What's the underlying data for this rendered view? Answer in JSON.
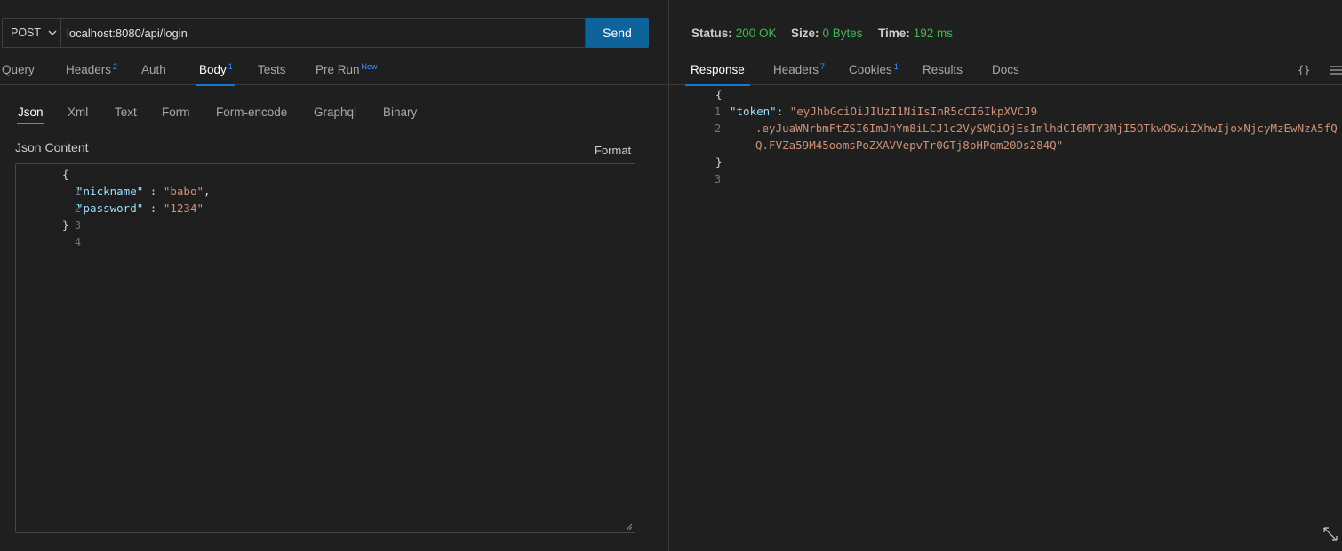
{
  "request": {
    "method": "POST",
    "url": "localhost:8080/api/login",
    "send_label": "Send"
  },
  "tabs": [
    {
      "label": "Query",
      "badge": ""
    },
    {
      "label": "Headers",
      "badge": "2"
    },
    {
      "label": "Auth",
      "badge": ""
    },
    {
      "label": "Body",
      "badge": "1"
    },
    {
      "label": "Tests",
      "badge": ""
    },
    {
      "label": "Pre Run",
      "badge": "New"
    }
  ],
  "body_tabs": [
    "Json",
    "Xml",
    "Text",
    "Form",
    "Form-encode",
    "Graphql",
    "Binary"
  ],
  "editor": {
    "label": "Json Content",
    "format_label": "Format",
    "line_numbers": [
      "1",
      "2",
      "3",
      "4"
    ],
    "open_brace": "{",
    "close_brace": "}",
    "key1": "\"nickname\"",
    "val1": "\"babo\"",
    "key2": "\"password\"",
    "val2": "\"1234\"",
    "colon": " : ",
    "comma": ","
  },
  "response": {
    "status_label": "Status:",
    "status_value": "200 OK",
    "size_label": "Size:",
    "size_value": "0 Bytes",
    "time_label": "Time:",
    "time_value": "192 ms",
    "tabs": [
      {
        "label": "Response",
        "badge": ""
      },
      {
        "label": "Headers",
        "badge": "7"
      },
      {
        "label": "Cookies",
        "badge": "1"
      },
      {
        "label": "Results",
        "badge": ""
      },
      {
        "label": "Docs",
        "badge": ""
      }
    ],
    "braces_icon_text": "{}",
    "line_numbers": [
      "1",
      "2",
      "3"
    ],
    "open_brace": "{",
    "close_brace": "}",
    "token_key": "\"token\"",
    "colon": ": ",
    "token_part1": "\"eyJhbGciOiJIUzI1NiIsInR5cCI6IkpXVCJ9",
    "token_part2": ".eyJuaWNrbmFtZSI6ImJhYm8iLCJ1c2VySWQiOjEsImlhdCI6MTY3MjI5OTkwOSwiZXhwIjoxNjcyMzEwNzA5fQ",
    "token_part3": "Q.FVZa59M45oomsPoZXAVVepvTr0GTj8pHPqm20Ds284Q\""
  }
}
